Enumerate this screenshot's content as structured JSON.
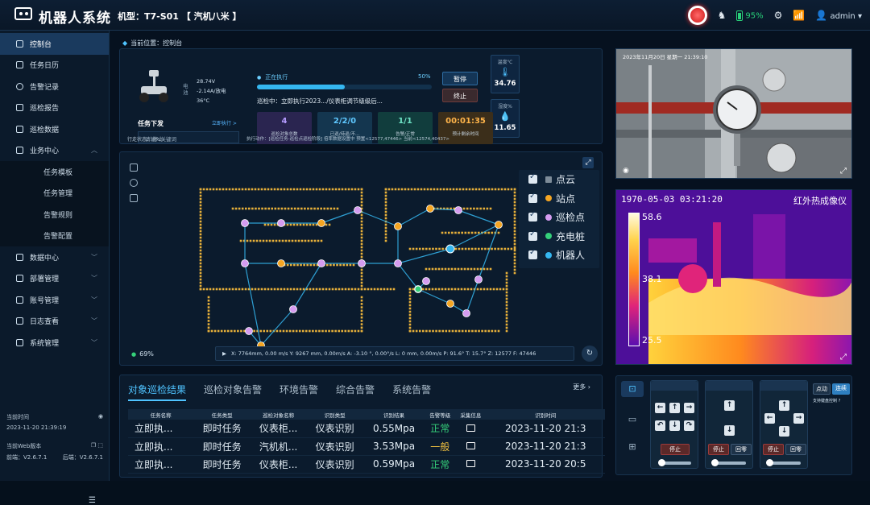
{
  "header": {
    "app_title": "机器人系统",
    "model_label": "机型：T7-S01 【 汽机八米 】",
    "battery": "95%",
    "user": "admin"
  },
  "sidebar": {
    "items": [
      {
        "label": "控制台",
        "active": true
      },
      {
        "label": "任务日历"
      },
      {
        "label": "告警记录"
      },
      {
        "label": "巡检报告"
      },
      {
        "label": "巡检数据"
      },
      {
        "label": "业务中心",
        "expanded": true
      }
    ],
    "subitems": [
      "任务模板",
      "任务管理",
      "告警规则",
      "告警配置"
    ],
    "items2": [
      "数据中心",
      "部署管理",
      "账号管理",
      "日志查看",
      "系统管理"
    ],
    "info": {
      "time_label": "当前时间",
      "time_value": "2023-11-20 21:39:19",
      "version_label": "当前Web版本",
      "front": "前端：V2.6.7.1",
      "back": "后端：V2.6.7.1"
    }
  },
  "breadcrumb": {
    "label": "当前位置：",
    "page": "控制台"
  },
  "robot": {
    "spec_label": "电池",
    "voltage": "28.74V",
    "current": "-2.14A/放电",
    "temp": "36°C"
  },
  "execution": {
    "status": "正在执行",
    "percent_text": "50%",
    "progress": 0.5,
    "task": "巡检中：立即执行2023.../仪表柜调节级级后...",
    "pause_label": "暂停",
    "stop_label": "终止"
  },
  "gauges": [
    {
      "label": "温度℃",
      "value": "34.76"
    },
    {
      "label": "湿度%",
      "value": "11.65"
    }
  ],
  "tiles": [
    {
      "value": "4",
      "label": "巡检对象总数",
      "color": "#b59cff",
      "bg": "#2a2550"
    },
    {
      "value": "2/2/0",
      "label": "已巡/待巡/不...",
      "color": "#5fc8ff",
      "bg": "#14364f"
    },
    {
      "value": "1/1",
      "label": "告警/正常",
      "color": "#6fe3c6",
      "bg": "#113d3d"
    },
    {
      "value": "00:01:35",
      "label": "预计剩余时间",
      "color": "#ffb44a",
      "bg": "#3b2e1a"
    }
  ],
  "task_issue": {
    "title": "任务下发",
    "link": "立即执行 >",
    "placeholder": "请输入关键词"
  },
  "status_line": {
    "left": "行走状态：  停止",
    "right": "执行动作：[巡检任务-巡检点巡检阶段] 倍率数据设置中 预置<12577,47446> 当前<12574,40437>"
  },
  "map": {
    "zoom": "69%",
    "legend": [
      {
        "label": "点云",
        "color": "#7d8c99"
      },
      {
        "label": "站点",
        "color": "#f5a623"
      },
      {
        "label": "巡检点",
        "color": "#d59cf0"
      },
      {
        "label": "充电桩",
        "color": "#35d07a"
      },
      {
        "label": "机器人",
        "color": "#35b7f0"
      }
    ],
    "coords": "X: 7764mm,  0.00 m/s    Y: 9267 mm,  0.00m/s    A: -3.10 °,  0.00°/s    L: 0 mm,  0.00m/s    P: 91.6°    T: 15.7°    Z: 12577    F: 47446"
  },
  "results": {
    "tabs": [
      "对象巡检结果",
      "巡检对象告警",
      "环境告警",
      "综合告警",
      "系统告警"
    ],
    "more": "更多 ›",
    "columns": [
      "任务名称",
      "任务类型",
      "巡检对象名称",
      "识别类型",
      "识别结果",
      "告警等级",
      "采集信息",
      "识别时间"
    ],
    "rows": [
      [
        "立即执...",
        "即时任务",
        "仪表柜...",
        "仪表识别",
        "0.55Mpa",
        "正常",
        "2023-11-20 21:3"
      ],
      [
        "立即执...",
        "即时任务",
        "汽机机...",
        "仪表识别",
        "3.53Mpa",
        "一般",
        "2023-11-20 21:3"
      ],
      [
        "立即执...",
        "即时任务",
        "仪表柜...",
        "仪表识别",
        "0.59Mpa",
        "正常",
        "2023-11-20 20:5"
      ]
    ],
    "level_colors": {
      "正常": "#35d07a",
      "一般": "#f0c040"
    }
  },
  "camera": {
    "timestamp": "2023年11月20日 星期一 21:39:10"
  },
  "thermal": {
    "timestamp": "1970-05-03  03:21:20",
    "title": "红外热成像仪",
    "max": "58.6",
    "mid": "38.1",
    "min": "25.5"
  },
  "control": {
    "stop": "停止",
    "home": "回零",
    "mode_a": "点动",
    "mode_b": "连续",
    "support": "支持键盘控制"
  }
}
